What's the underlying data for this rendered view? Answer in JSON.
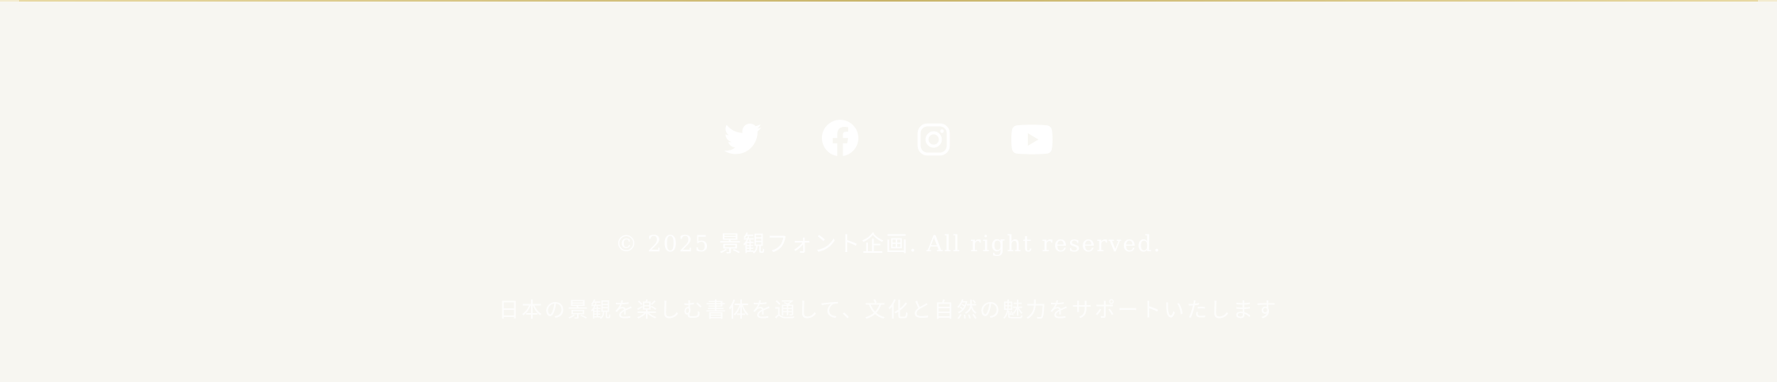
{
  "colors": {
    "background": "#f7f6f1",
    "accent_rule": "#c9b46a",
    "text": "#ffffff",
    "icon": "#ffffff"
  },
  "social": {
    "items": [
      {
        "icon": "twitter-icon"
      },
      {
        "icon": "facebook-icon"
      },
      {
        "icon": "instagram-icon"
      },
      {
        "icon": "youtube-icon"
      }
    ]
  },
  "footer": {
    "copyright": "© 2025 景観フォント企画. All right reserved.",
    "tagline": "日本の景観を楽しむ書体を通して、文化と自然の魅力をサポートいたします"
  }
}
